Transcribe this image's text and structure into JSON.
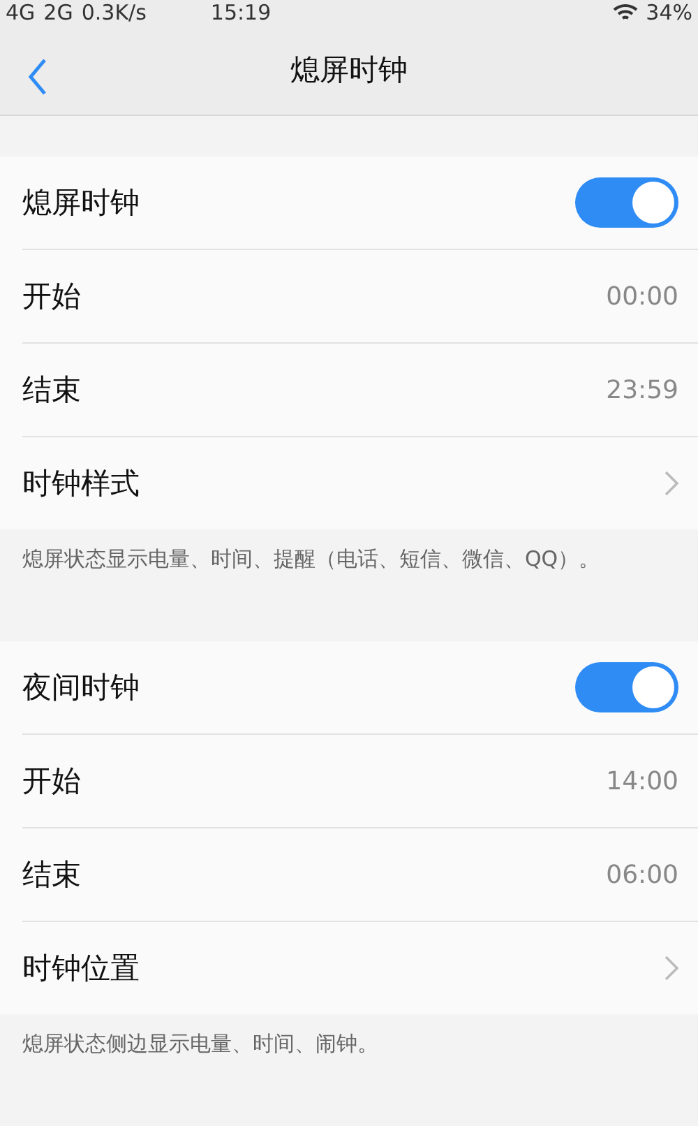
{
  "status_bar": {
    "left": [
      "4G",
      "2G",
      "0.3K/s"
    ],
    "time": "15:19",
    "battery": "34%"
  },
  "header": {
    "title": "熄屏时钟"
  },
  "sections": [
    {
      "rows": [
        {
          "kind": "toggle",
          "label": "熄屏时钟",
          "on": true
        },
        {
          "kind": "value",
          "label": "开始",
          "value": "00:00"
        },
        {
          "kind": "value",
          "label": "结束",
          "value": "23:59"
        },
        {
          "kind": "link",
          "label": "时钟样式"
        }
      ],
      "note": "熄屏状态显示电量、时间、提醒（电话、短信、微信、QQ）。"
    },
    {
      "rows": [
        {
          "kind": "toggle",
          "label": "夜间时钟",
          "on": true
        },
        {
          "kind": "value",
          "label": "开始",
          "value": "14:00"
        },
        {
          "kind": "value",
          "label": "结束",
          "value": "06:00"
        },
        {
          "kind": "link",
          "label": "时钟位置"
        }
      ],
      "note": "熄屏状态侧边显示电量、时间、闹钟。"
    }
  ]
}
